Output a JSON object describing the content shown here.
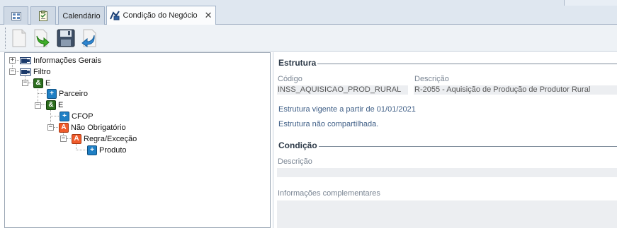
{
  "tabs": [
    {
      "label": "",
      "icon": "grid-icon"
    },
    {
      "label": "",
      "icon": "clipboard-icon"
    },
    {
      "label": "Calendário"
    },
    {
      "label": "Condição do Negócio",
      "icon": "business-icon",
      "active": true,
      "close": "✕"
    }
  ],
  "toolbar": {
    "buttons": [
      "new-document-icon",
      "forward-arrow-icon",
      "save-icon",
      "back-arrow-icon"
    ]
  },
  "tree": {
    "items": [
      {
        "label": "Informações Gerais",
        "expander": "+"
      },
      {
        "label": "Filtro",
        "expander": "−"
      },
      {
        "label": "E",
        "icon": "&",
        "expander": "−"
      },
      {
        "label": "Parceiro",
        "icon": "+"
      },
      {
        "label": "E",
        "icon": "&",
        "expander": "−"
      },
      {
        "label": "CFOP",
        "icon": "+"
      },
      {
        "label": "Não Obrigatório",
        "icon": "A",
        "expander": "−"
      },
      {
        "label": "Regra/Exceção",
        "icon": "A",
        "expander": "−"
      },
      {
        "label": "Produto",
        "icon": "+"
      }
    ]
  },
  "estrutura": {
    "title": "Estrutura",
    "codigo_label": "Código",
    "codigo_value": "INSS_AQUISICAO_PROD_RURAL",
    "descricao_label": "Descrição",
    "descricao_value": "R-2055 - Aquisição de Produção de Produtor Rural",
    "vigente": "Estrutura vigente a partir de 01/01/2021",
    "compartilhada": "Estrutura não compartilhada."
  },
  "condicao": {
    "title": "Condição",
    "descricao_label": "Descrição",
    "descricao_value": "",
    "info_label": "Informações complementares",
    "info_value": ""
  }
}
